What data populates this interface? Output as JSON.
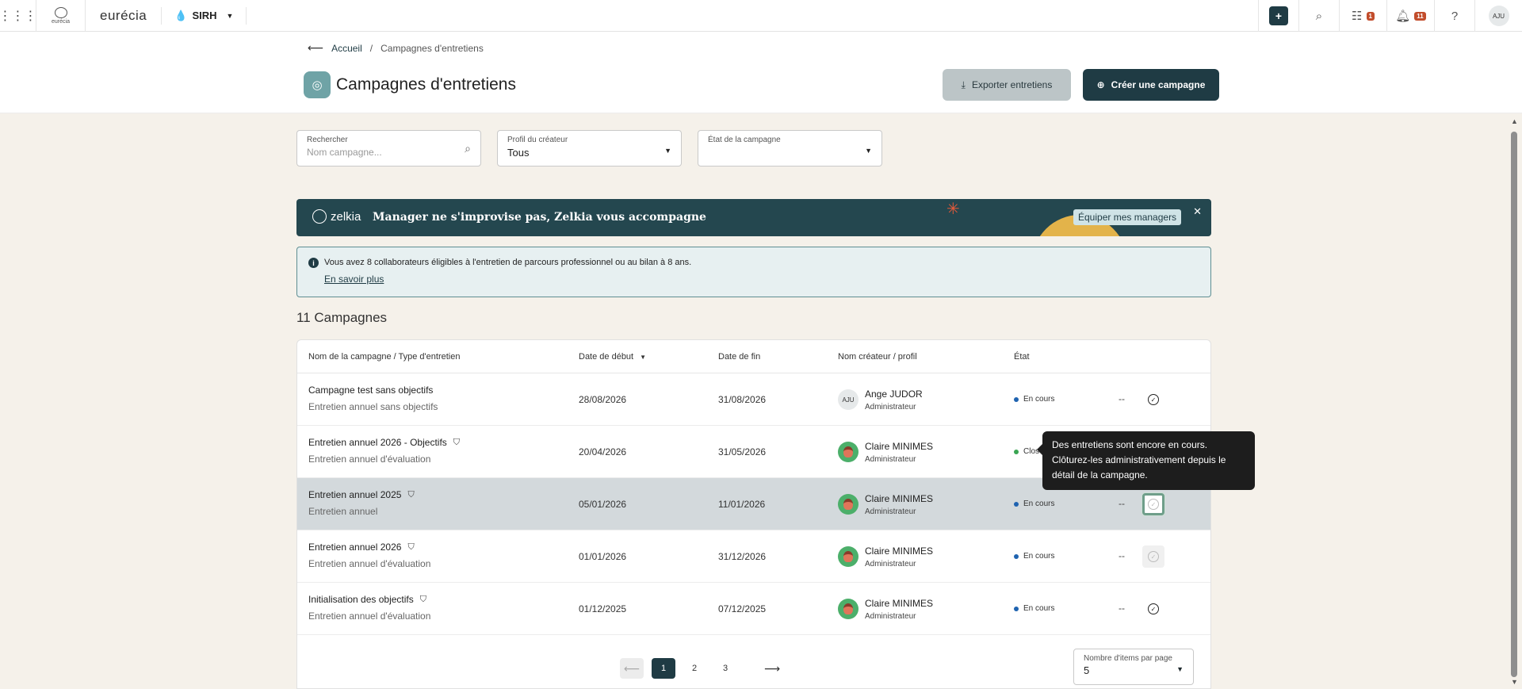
{
  "topbar": {
    "grid_icon": "grid-icon",
    "logo_small_text": "eurécia",
    "brand": "eurécia",
    "module": "SIRH",
    "tasks_badge": "1",
    "notifications_badge": "11",
    "user_initials": "AJU"
  },
  "breadcrumb": {
    "home": "Accueil",
    "current": "Campagnes d'entretiens"
  },
  "page": {
    "title": "Campagnes d'entretiens",
    "export_label": "Exporter entretiens",
    "create_label": "Créer une campagne"
  },
  "filters": {
    "search_label": "Rechercher",
    "search_placeholder": "Nom campagne...",
    "creator_label": "Profil du créateur",
    "creator_value": "Tous",
    "state_label": "État de la campagne",
    "state_value": ""
  },
  "banner": {
    "logo": "zelkia",
    "message": "Manager ne s'improvise pas, Zelkia vous accompagne",
    "cta": "Équiper mes managers"
  },
  "info": {
    "text": "Vous avez 8 collaborateurs éligibles à l'entretien de parcours professionnel ou au bilan à 8 ans.",
    "link": "En savoir plus"
  },
  "count_label": "11 Campagnes",
  "table": {
    "headers": {
      "name": "Nom de la campagne / Type d'entretien",
      "start": "Date de début",
      "end": "Date de fin",
      "creator": "Nom créateur / profil",
      "state": "État"
    },
    "rows": [
      {
        "name": "Campagne test sans objectifs",
        "type": "Entretien annuel sans objectifs",
        "start": "28/08/2026",
        "end": "31/08/2026",
        "creator": "Ange JUDOR",
        "profile": "Administrateur",
        "initials": "AJU",
        "state": "En cours",
        "state_color": "#1f63b0",
        "dash": "--"
      },
      {
        "name": "Entretien annuel 2026 - Objectifs",
        "type": "Entretien annuel d'évaluation",
        "start": "20/04/2026",
        "end": "31/05/2026",
        "creator": "Claire MINIMES",
        "profile": "Administrateur",
        "state": "Clos",
        "state_color": "#3aa552",
        "dash": ""
      },
      {
        "name": "Entretien annuel 2025",
        "type": "Entretien annuel",
        "start": "05/01/2026",
        "end": "11/01/2026",
        "creator": "Claire MINIMES",
        "profile": "Administrateur",
        "state": "En cours",
        "state_color": "#1f63b0",
        "dash": "--"
      },
      {
        "name": "Entretien annuel 2026",
        "type": "Entretien annuel d'évaluation",
        "start": "01/01/2026",
        "end": "31/12/2026",
        "creator": "Claire MINIMES",
        "profile": "Administrateur",
        "state": "En cours",
        "state_color": "#1f63b0",
        "dash": "--"
      },
      {
        "name": "Initialisation des objectifs",
        "type": "Entretien annuel d'évaluation",
        "start": "01/12/2025",
        "end": "07/12/2025",
        "creator": "Claire MINIMES",
        "profile": "Administrateur",
        "state": "En cours",
        "state_color": "#1f63b0",
        "dash": "--"
      }
    ]
  },
  "tooltip": "Des entretiens sont encore en cours. Clôturez-les administrativement depuis le détail de la campagne.",
  "pagination": {
    "pages": [
      "1",
      "2",
      "3"
    ],
    "per_page_label": "Nombre d'items par page",
    "per_page_value": "5"
  }
}
